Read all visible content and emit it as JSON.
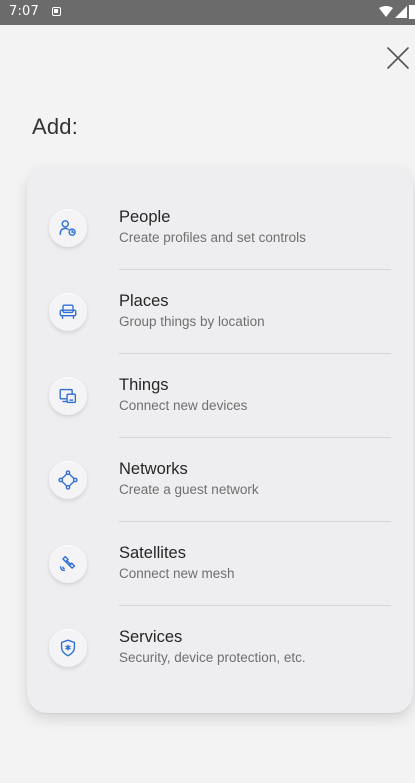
{
  "status_bar": {
    "time": "7:07"
  },
  "header": {
    "title": "Add:"
  },
  "colors": {
    "accent": "#2f6fd4",
    "background": "#f3f3f4",
    "card": "#eeeef0"
  },
  "items": [
    {
      "label": "People",
      "subtitle": "Create profiles and set controls",
      "icon": "people-icon"
    },
    {
      "label": "Places",
      "subtitle": "Group things by location",
      "icon": "sofa-icon"
    },
    {
      "label": "Things",
      "subtitle": "Connect new devices",
      "icon": "devices-icon"
    },
    {
      "label": "Networks",
      "subtitle": "Create a guest network",
      "icon": "network-icon"
    },
    {
      "label": "Satellites",
      "subtitle": "Connect new mesh",
      "icon": "satellite-icon"
    },
    {
      "label": "Services",
      "subtitle": "Security, device protection, etc.",
      "icon": "shield-icon"
    }
  ]
}
